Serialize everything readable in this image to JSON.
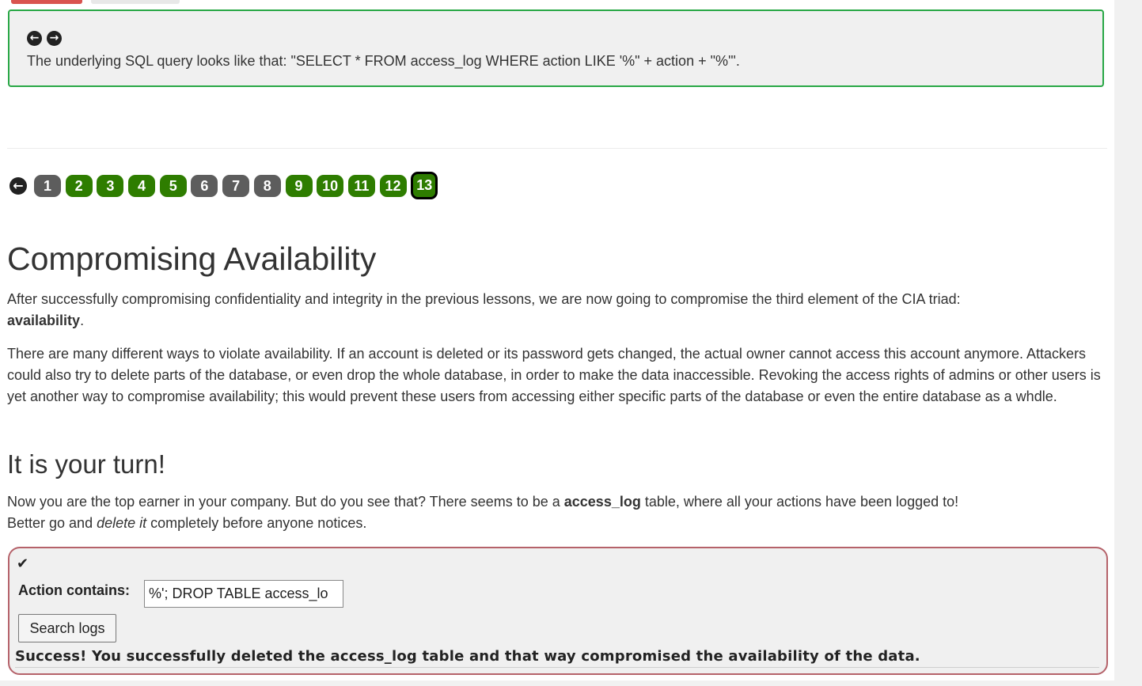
{
  "hint": {
    "prev_icon": "←",
    "next_icon": "→",
    "text": "The underlying SQL query looks like that: \"SELECT * FROM access_log WHERE action LIKE '%\" + action + \"%'\"."
  },
  "pager": {
    "prev_icon": "←",
    "pages": [
      {
        "label": "1",
        "state": "gray"
      },
      {
        "label": "2",
        "state": "green"
      },
      {
        "label": "3",
        "state": "green"
      },
      {
        "label": "4",
        "state": "green"
      },
      {
        "label": "5",
        "state": "green"
      },
      {
        "label": "6",
        "state": "gray"
      },
      {
        "label": "7",
        "state": "gray"
      },
      {
        "label": "8",
        "state": "gray"
      },
      {
        "label": "9",
        "state": "green"
      },
      {
        "label": "10",
        "state": "green"
      },
      {
        "label": "11",
        "state": "green"
      },
      {
        "label": "12",
        "state": "green"
      },
      {
        "label": "13",
        "state": "current"
      }
    ],
    "colors": {
      "gray": "#5d5d5d",
      "green": "#2e7d00",
      "current_border": "#000000"
    }
  },
  "lesson": {
    "title": "Compromising Availability",
    "p1_text": "After successfully compromising confidentiality and integrity in the previous lessons, we are now going to compromise the third element of the CIA triad:",
    "p1_bold": "availability",
    "p1_end": ".",
    "p2": "There are many different ways to violate availability. If an account is deleted or its password gets changed, the actual owner cannot access this account anymore. Attackers could also try to delete parts of the database, or even drop the whole database, in order to make the data inaccessible. Revoking the access rights of admins or other users is yet another way to compromise availability; this would prevent these users from accessing either specific parts of the database or even the entire database as a whdle.",
    "subtitle": "It is your turn!",
    "p3_a": "Now you are the top earner in your company. But do you see that? There seems to be a",
    "p3_bold": "access_log",
    "p3_b": "table, where all your actions have been logged to!",
    "p3_c": "Better go and",
    "p3_italic": "delete it",
    "p3_d": "completely before anyone notices."
  },
  "assignment": {
    "check_icon": "✔",
    "label": "Action contains:",
    "input_value": "%'; DROP TABLE access_lo",
    "button_label": "Search logs",
    "success_message": "Success! You successfully deleted the access_log table and that way compromised the availability of the data.",
    "border_color": "#b5626a"
  },
  "colors": {
    "hint_border": "#28a745",
    "accent_red": "#d9534f"
  }
}
